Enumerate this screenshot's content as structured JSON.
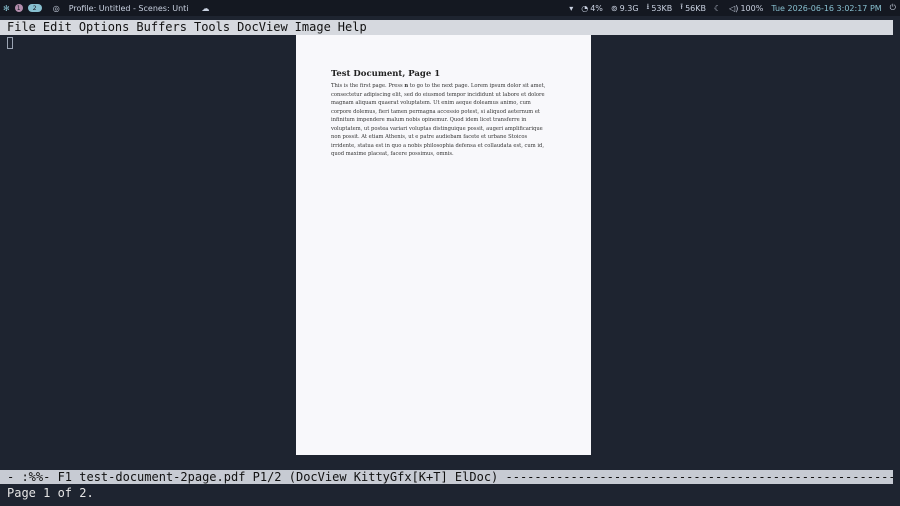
{
  "topbar": {
    "workspaces": [
      "1",
      "2"
    ],
    "window_title": "Profile: Untitled - Scenes: Unti",
    "cpu": "4%",
    "memory": "9.3G",
    "net_down": "53KB",
    "net_up": "56KB",
    "volume": "100%",
    "clock": "Tue 2026-06-16 3:02:17 PM",
    "icons": [
      "app-launcher-icon",
      "workspace-indicator",
      "globe-icon",
      "weather-icon",
      "tray-dropdown-icon",
      "cpu-icon",
      "memory-icon",
      "download-icon",
      "upload-icon",
      "notification-icon",
      "volume-icon",
      "power-icon"
    ]
  },
  "menubar": {
    "items": [
      "File",
      "Edit",
      "Options",
      "Buffers",
      "Tools",
      "DocView",
      "Image",
      "Help"
    ]
  },
  "document": {
    "heading": "Test Document, Page 1",
    "body_pre": "This is the first page. Press ",
    "body_key": "n",
    "body_post": " to go to the next page. Lorem ipsum dolor sit amet, consectetur adipiscing elit, sed do eiusmod tempor incididunt ut labore et dolore magnam aliquam quaerat voluptatem. Ut enim aeque doleamus animo, cum corpore dolemus, fieri tamen permagna accessio potest, si aliquod aeternum et infinitum impendere malum nobis opinemur. Quod idem licet transferre in voluptatem, ut postea variari voluptas distinguique possit, augeri amplificarique non possit. At etiam Athenis, ut e patre audiebam facete et urbane Stoicos irridente, statua est in quo a nobis philosophia defensa et collaudata est, cum id, quod maxime placeat, facere possimus, omnis."
  },
  "modeline": {
    "text": "-  :%%- F1  test-document-2page.pdf    P1/2  (DocView KittyGfx[K+T] ElDoc) -----------------------------------------------------------------------------"
  },
  "minibuffer": {
    "message": "Page 1 of 2."
  }
}
